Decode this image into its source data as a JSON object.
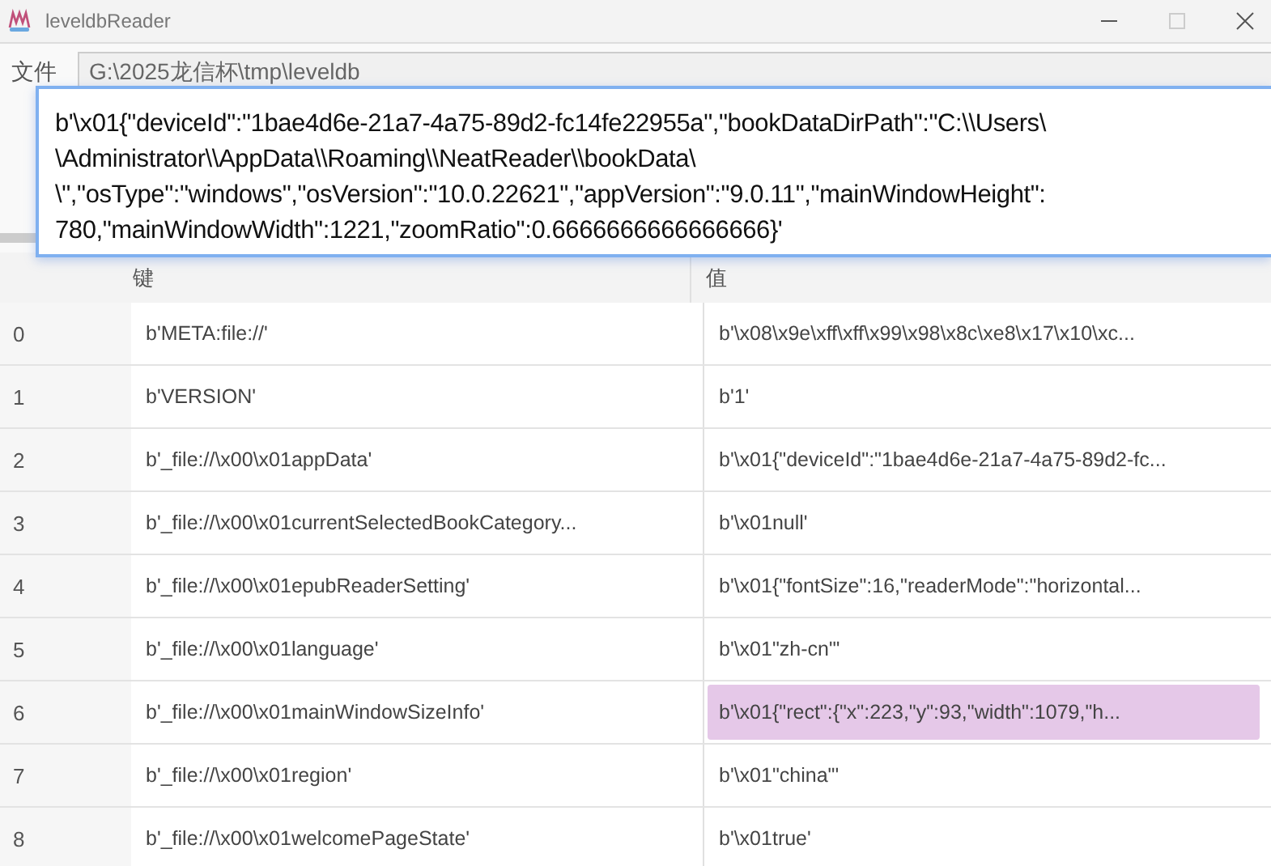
{
  "window": {
    "title": "leveldbReader"
  },
  "file": {
    "label": "文件",
    "value": "G:\\2025龙信杯\\tmp\\leveldb"
  },
  "tooltip": {
    "lines": [
      "b'\\x01{\"deviceId\":\"1bae4d6e-21a7-4a75-89d2-fc14fe22955a\",\"bookDataDirPath\":\"C:\\\\Users\\",
      "\\Administrator\\\\AppData\\\\Roaming\\\\NeatReader\\\\bookData\\",
      "\\\",\"osType\":\"windows\",\"osVersion\":\"10.0.22621\",\"appVersion\":\"9.0.11\",\"mainWindowHeight\":",
      "780,\"mainWindowWidth\":1221,\"zoomRatio\":0.6666666666666666}'"
    ]
  },
  "table": {
    "columns": [
      "键",
      "值"
    ],
    "rows": [
      {
        "index": "0",
        "key": "b'META:file://'",
        "value": "b'\\x08\\x9e\\xff\\xff\\x99\\x98\\x8c\\xe8\\x17\\x10\\xc...",
        "selected": false
      },
      {
        "index": "1",
        "key": "b'VERSION'",
        "value": "b'1'",
        "selected": false
      },
      {
        "index": "2",
        "key": "b'_file://\\x00\\x01appData'",
        "value": "b'\\x01{\"deviceId\":\"1bae4d6e-21a7-4a75-89d2-fc...",
        "selected": false
      },
      {
        "index": "3",
        "key": "b'_file://\\x00\\x01currentSelectedBookCategory...",
        "value": "b'\\x01null'",
        "selected": false
      },
      {
        "index": "4",
        "key": "b'_file://\\x00\\x01epubReaderSetting'",
        "value": "b'\\x01{\"fontSize\":16,\"readerMode\":\"horizontal...",
        "selected": false
      },
      {
        "index": "5",
        "key": "b'_file://\\x00\\x01language'",
        "value": "b'\\x01\"zh-cn\"'",
        "selected": false
      },
      {
        "index": "6",
        "key": "b'_file://\\x00\\x01mainWindowSizeInfo'",
        "value": "b'\\x01{\"rect\":{\"x\":223,\"y\":93,\"width\":1079,\"h...",
        "selected": true
      },
      {
        "index": "7",
        "key": "b'_file://\\x00\\x01region'",
        "value": "b'\\x01\"china\"'",
        "selected": false
      },
      {
        "index": "8",
        "key": "b'_file://\\x00\\x01welcomePageState'",
        "value": "b'\\x01true'",
        "selected": false
      }
    ]
  }
}
